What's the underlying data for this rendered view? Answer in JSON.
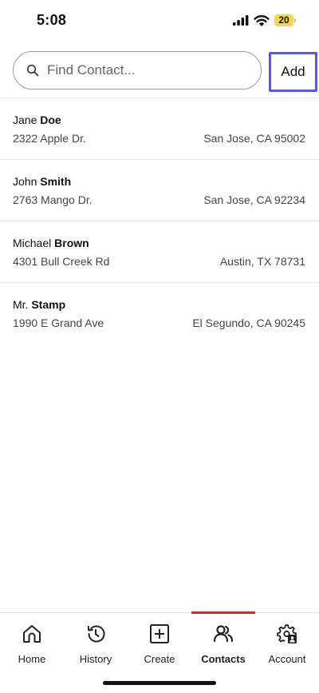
{
  "status_bar": {
    "time": "5:08",
    "battery_level": "20",
    "battery_color": "#f5d84a"
  },
  "search": {
    "placeholder": "Find Contact...",
    "value": ""
  },
  "add_button": {
    "label": "Add",
    "border_color": "#5a55f0"
  },
  "contacts": [
    {
      "first": "Jane",
      "last": "Doe",
      "street": "2322 Apple Dr.",
      "city": "San Jose, CA 95002"
    },
    {
      "first": "John",
      "last": "Smith",
      "street": "2763 Mango Dr.",
      "city": "San Jose, CA 92234"
    },
    {
      "first": "Michael",
      "last": "Brown",
      "street": "4301 Bull Creek Rd",
      "city": "Austin, TX 78731"
    },
    {
      "first": "Mr.",
      "last": "Stamp",
      "street": "1990 E Grand Ave",
      "city": "El Segundo, CA 90245"
    }
  ],
  "tabs": [
    {
      "label": "Home",
      "icon": "home-icon",
      "active": false
    },
    {
      "label": "History",
      "icon": "history-icon",
      "active": false
    },
    {
      "label": "Create",
      "icon": "create-icon",
      "active": false
    },
    {
      "label": "Contacts",
      "icon": "contacts-icon",
      "active": true
    },
    {
      "label": "Account",
      "icon": "account-settings-icon",
      "active": false
    }
  ],
  "active_tab_color": "#e02424"
}
